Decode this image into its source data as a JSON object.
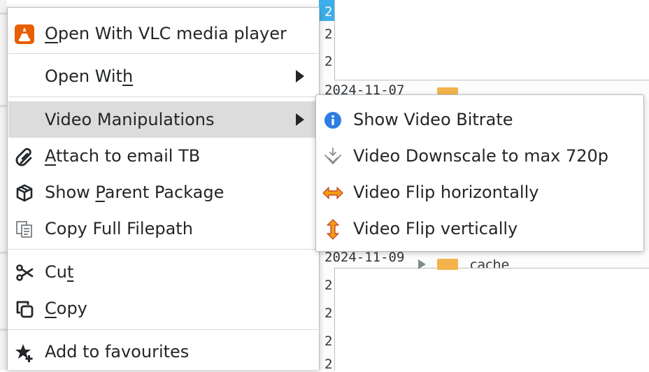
{
  "background": {
    "date_full_1": "2024-11-07",
    "date_full_2": "2024-11-09",
    "date_short": "2",
    "folder_label": "cache"
  },
  "context_menu": {
    "items": [
      {
        "id": "open-with-vlc",
        "before": "",
        "mnemonic": "O",
        "after": "pen With VLC media player",
        "icon": "vlc-icon"
      },
      {
        "id": "open-with",
        "before": "Open Wit",
        "mnemonic": "h",
        "after": "",
        "icon": "",
        "submenu": true
      },
      {
        "id": "video-manipulations",
        "before": "Video Manipulations",
        "mnemonic": "",
        "after": "",
        "icon": "",
        "submenu": true,
        "highlighted": true
      },
      {
        "id": "attach-to-email",
        "before": "",
        "mnemonic": "A",
        "after": "ttach to email TB",
        "icon": "attachment-icon"
      },
      {
        "id": "show-parent-package",
        "before": "Show ",
        "mnemonic": "P",
        "after": "arent Package",
        "icon": "package-icon"
      },
      {
        "id": "copy-full-filepath",
        "before": "Copy Full Filepath",
        "mnemonic": "",
        "after": "",
        "icon": "copy-path-icon"
      },
      {
        "id": "cut",
        "before": "Cu",
        "mnemonic": "t",
        "after": "",
        "icon": "scissors-icon"
      },
      {
        "id": "copy",
        "before": "",
        "mnemonic": "C",
        "after": "opy",
        "icon": "copy-icon"
      },
      {
        "id": "add-to-favourites",
        "before": "Add to favourites",
        "mnemonic": "",
        "after": "",
        "icon": "star-add-icon"
      }
    ]
  },
  "video_submenu": {
    "items": [
      {
        "id": "show-video-bitrate",
        "label": "Show Video Bitrate",
        "icon": "info-icon"
      },
      {
        "id": "video-downscale",
        "label": "Video Downscale to max 720p",
        "icon": "downscale-icon"
      },
      {
        "id": "video-flip-horizontal",
        "label": "Video Flip horizontally",
        "icon": "flip-horizontal-icon"
      },
      {
        "id": "video-flip-vertical",
        "label": "Video Flip vertically",
        "icon": "flip-vertical-icon"
      }
    ]
  },
  "colors": {
    "highlight": "#dcdcdc",
    "selection": "#3daee9",
    "vlc_orange": "#e85e00",
    "info_blue": "#2f7de1",
    "flip_orange": "#e67e22"
  }
}
